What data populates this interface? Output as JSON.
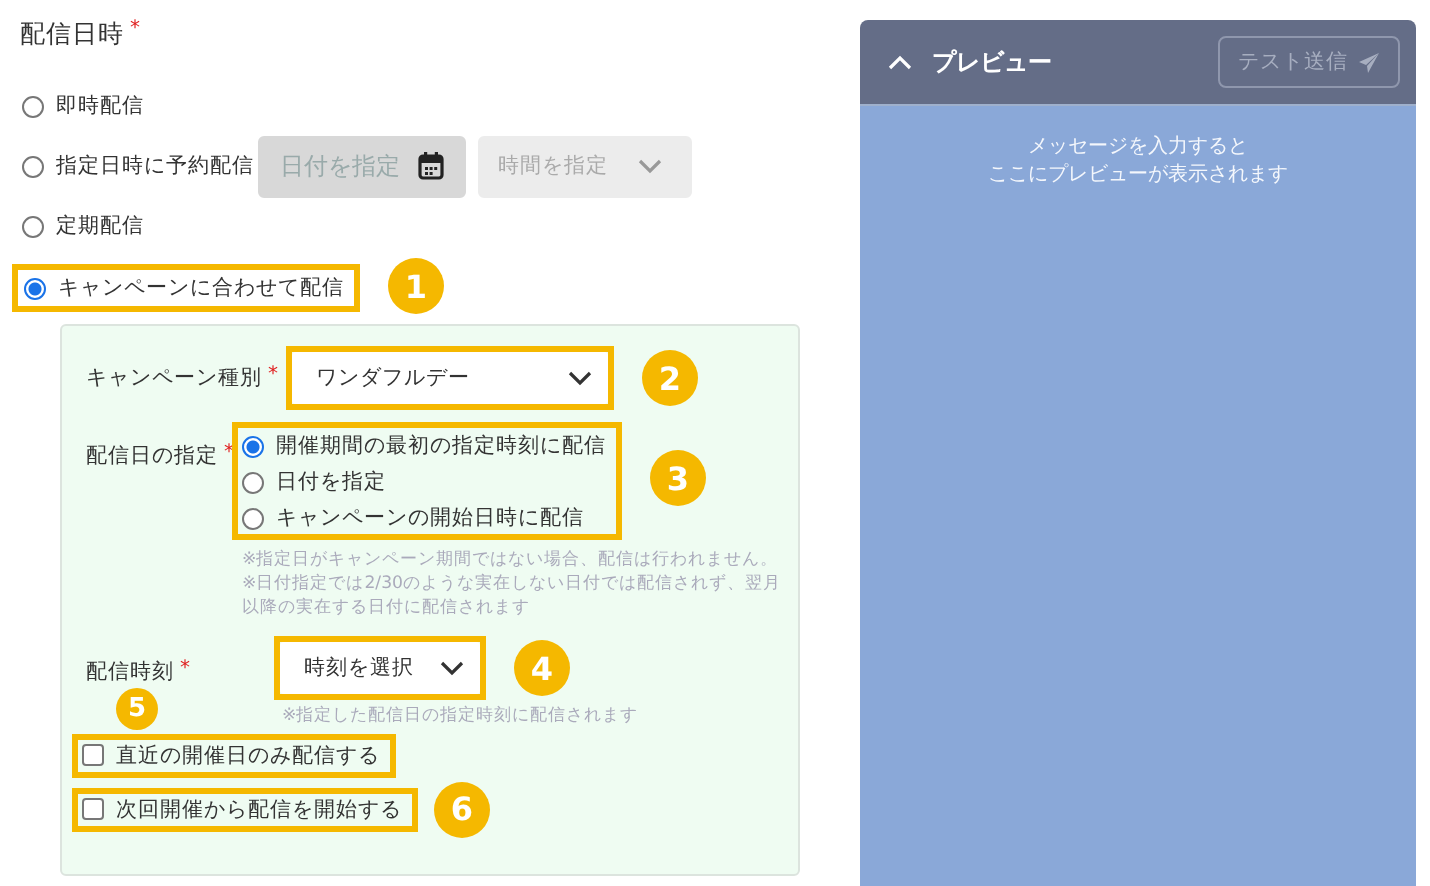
{
  "section": {
    "label": "配信日時",
    "required_mark": "*"
  },
  "schedule_options": [
    {
      "label": "即時配信",
      "selected": false
    },
    {
      "label": "指定日時に予約配信",
      "selected": false,
      "date_field": {
        "placeholder": "日付を指定",
        "disabled": true
      },
      "time_select": {
        "placeholder": "時間を指定",
        "disabled": true
      }
    },
    {
      "label": "定期配信",
      "selected": false
    },
    {
      "label": "キャンペーンに合わせて配信",
      "selected": true,
      "callout": "1"
    }
  ],
  "campaign": {
    "type_field": {
      "label": "キャンペーン種別",
      "required_mark": "*",
      "value": "ワンダフルデー",
      "callout": "2"
    },
    "date_spec": {
      "label": "配信日の指定",
      "required_mark": "*",
      "callout": "3",
      "options": [
        {
          "label": "開催期間の最初の指定時刻に配信",
          "selected": true
        },
        {
          "label": "日付を指定",
          "selected": false
        },
        {
          "label": "キャンペーンの開始日時に配信",
          "selected": false
        }
      ],
      "notes": [
        "※指定日がキャンペーン期間ではない場合、配信は行われません。",
        "※日付指定では2/30のような実在しない日付では配信されず、翌月以降の実在する日付に配信されます"
      ]
    },
    "time": {
      "label": "配信時刻",
      "required_mark": "*",
      "placeholder": "時刻を選択",
      "callout": "4",
      "note": "※指定した配信日の指定時刻に配信されます"
    },
    "checkboxes": [
      {
        "label": "直近の開催日のみ配信する",
        "checked": false,
        "callout": "5"
      },
      {
        "label": "次回開催から配信を開始する",
        "checked": false,
        "callout": "6"
      }
    ]
  },
  "preview": {
    "title": "プレビュー",
    "expanded": true,
    "test_button": "テスト送信",
    "message": [
      "メッセージを入力すると",
      "ここにプレビューが表示されます"
    ]
  }
}
